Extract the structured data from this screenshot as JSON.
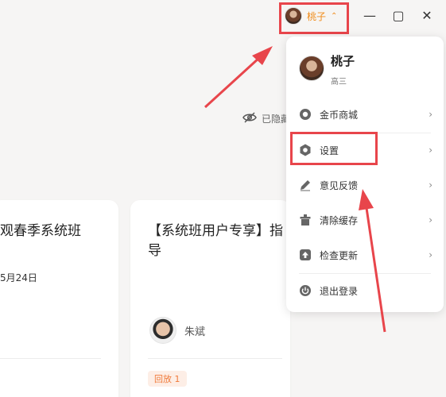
{
  "topbar": {
    "user_name": "桃子",
    "caret": "⌃",
    "minimize": "—",
    "maximize": "▢",
    "close": "✕"
  },
  "hidden_toggle": {
    "label": "已隐藏"
  },
  "cards": [
    {
      "title": "观春季系统班",
      "date": "5月24日"
    },
    {
      "title": "【系统班用户专享】指导",
      "teacher": "朱斌",
      "tag": "回放 1"
    }
  ],
  "dropdown": {
    "name": "桃子",
    "grade": "高三",
    "items": [
      {
        "label": "金币商城",
        "icon": "coin-icon"
      },
      {
        "label": "设置",
        "icon": "gear-icon"
      },
      {
        "label": "意见反馈",
        "icon": "pencil-icon"
      },
      {
        "label": "清除缓存",
        "icon": "trash-icon"
      },
      {
        "label": "检查更新",
        "icon": "upload-icon"
      },
      {
        "label": "退出登录",
        "icon": "power-icon"
      }
    ],
    "chevron": "›"
  },
  "colors": {
    "accent": "#f08c1a",
    "annotation": "#e8454b",
    "tag_bg": "#fdeee6",
    "tag_text": "#f07a3a"
  }
}
